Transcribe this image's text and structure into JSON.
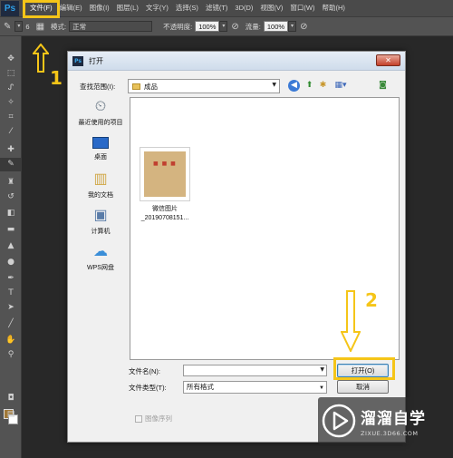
{
  "app": {
    "logo_text": "Ps"
  },
  "menubar": {
    "items": [
      "文件(F)",
      "编辑(E)",
      "图像(I)",
      "图层(L)",
      "文字(Y)",
      "选择(S)",
      "滤镜(T)",
      "3D(D)",
      "视图(V)",
      "窗口(W)",
      "帮助(H)"
    ]
  },
  "options_bar": {
    "brush_size": "6",
    "mode_label": "模式:",
    "mode_value": "正常",
    "opacity_label": "不透明度:",
    "opacity_value": "100%",
    "flow_label": "流量:",
    "flow_value": "100%"
  },
  "tools": {
    "icons": [
      "move-icon",
      "marquee-icon",
      "lasso-icon",
      "quick-select-icon",
      "crop-icon",
      "eyedropper-icon",
      "healing-icon",
      "brush-icon",
      "stamp-icon",
      "history-brush-icon",
      "eraser-icon",
      "gradient-icon",
      "blur-icon",
      "dodge-icon",
      "pen-icon",
      "type-icon",
      "path-select-icon",
      "line-icon",
      "hand-icon",
      "zoom-icon"
    ],
    "foreground_color": "#a07838",
    "background_color": "#ffffff"
  },
  "dialog": {
    "title": "打开",
    "look_in_label": "查找范围(I):",
    "look_in_value": "成品",
    "places": [
      {
        "label": "最近使用的项目",
        "icon": "recent-icon"
      },
      {
        "label": "桌面",
        "icon": "desktop-icon"
      },
      {
        "label": "我的文档",
        "icon": "documents-icon"
      },
      {
        "label": "计算机",
        "icon": "computer-icon"
      },
      {
        "label": "WPS网盘",
        "icon": "cloud-icon"
      }
    ],
    "files": [
      {
        "name_line1": "微信图片",
        "name_line2": "_20190708151..."
      }
    ],
    "file_name_label": "文件名(N):",
    "file_name_value": "",
    "file_type_label": "文件类型(T):",
    "file_type_value": "所有格式",
    "open_button": "打开(O)",
    "cancel_button": "取消",
    "image_sequence_label": "图像序列"
  },
  "annotations": {
    "step1": "1",
    "step2": "2",
    "color": "#f5c518"
  },
  "watermark": {
    "title": "溜溜自学",
    "subtitle": "ZIXUE.3D66.COM"
  }
}
